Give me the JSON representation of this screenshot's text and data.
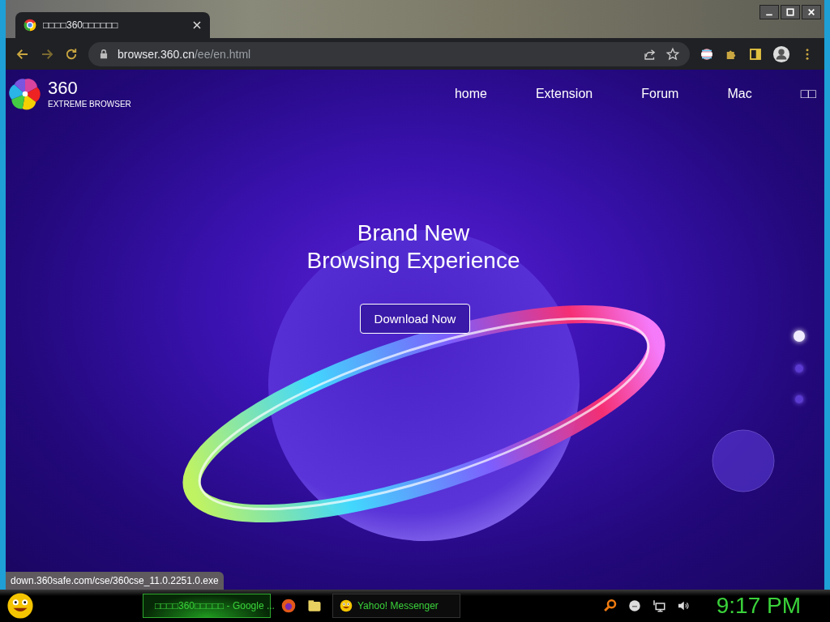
{
  "browser": {
    "tab": {
      "title": "□□□□360□□□□□□",
      "selected": true
    },
    "address": {
      "host": "browser.360.cn",
      "path": "/ee/en.html"
    }
  },
  "page": {
    "logo": {
      "number": "360",
      "tagline": "EXTREME BROWSER"
    },
    "nav": [
      {
        "label": "home"
      },
      {
        "label": "Extension"
      },
      {
        "label": "Forum"
      },
      {
        "label": "Mac"
      },
      {
        "label": "□□"
      }
    ],
    "hero": {
      "title_lines": [
        "Brand New",
        "Browsing Experience"
      ],
      "button": "Download Now"
    },
    "slides": [
      {
        "selected": true
      },
      {
        "selected": false
      },
      {
        "selected": false
      }
    ]
  },
  "status_url": "down.360safe.com/cse/360cse_11.0.2251.0.exe",
  "taskbar": {
    "tasks": [
      {
        "label": "□□□□360□□□□□ - Google ...",
        "selected": true
      },
      {
        "label": "Yahoo! Messenger",
        "selected": false
      }
    ],
    "clock": "9:17 PM"
  }
}
